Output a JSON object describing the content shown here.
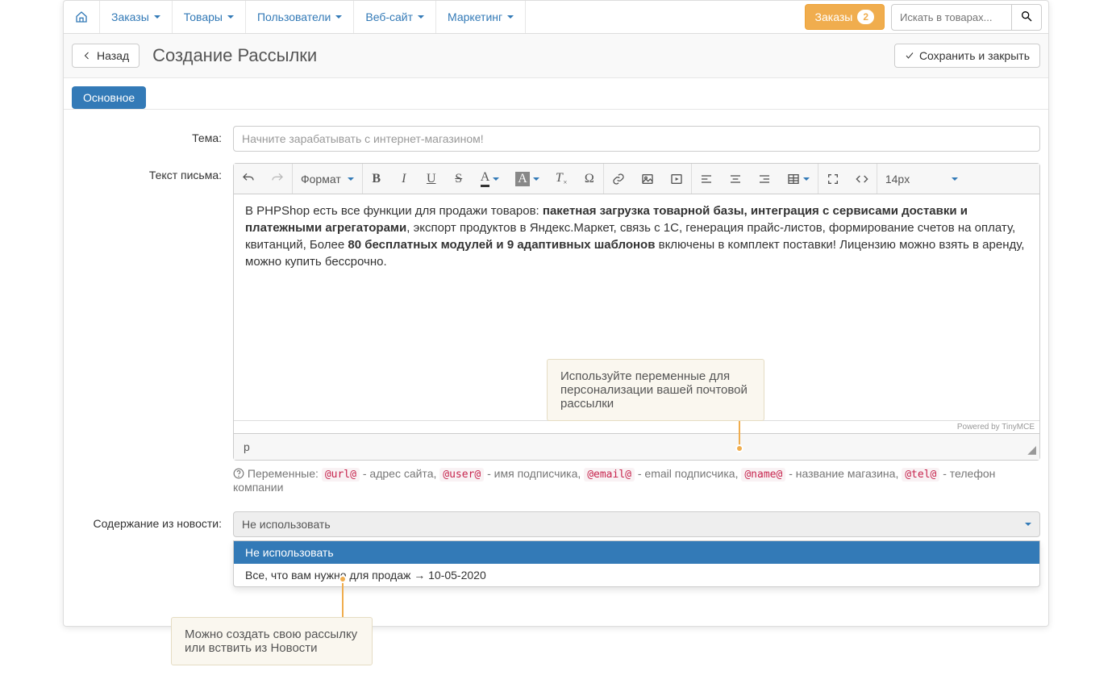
{
  "nav": {
    "items": [
      "Заказы",
      "Товары",
      "Пользователи",
      "Веб-сайт",
      "Маркетинг"
    ],
    "orders_button": "Заказы",
    "orders_badge": "2",
    "search_placeholder": "Искать в товарах..."
  },
  "header": {
    "back": "Назад",
    "title": "Создание Рассылки",
    "save": "Сохранить и закрыть"
  },
  "tabs": {
    "main": "Основное"
  },
  "form": {
    "subject_label": "Тема:",
    "subject_value": "Начните зарабатывать с интернет-магазином!",
    "body_label": "Текст письма:",
    "news_label": "Содержание из новости:"
  },
  "editor": {
    "format_label": "Формат",
    "fontsize_label": "14px",
    "powered": "Powered by TinyMCE",
    "path": "p",
    "content_pre": "В PHPShop есть все функции для продажи товаров: ",
    "content_bold1": "пакетная загрузка товарной базы, интеграция с сервисами доставки и платежными агрегаторами",
    "content_mid": ", экспорт продуктов в Яндекс.Маркет, связь с 1С, генерация прайс-листов, формирование счетов на оплату, квитанций, Более ",
    "content_bold2": "80 бесплатных модулей и 9 адаптивных шаблонов",
    "content_post": " включены в комплект поставки! Лицензию можно взять в аренду, можно купить бессрочно."
  },
  "variables": {
    "label": "Переменные: ",
    "url": "@url@",
    "url_desc": " - адрес сайта, ",
    "user": "@user@",
    "user_desc": " - имя подписчика, ",
    "email": "@email@",
    "email_desc": " - email подписчика, ",
    "name": "@name@",
    "name_desc": " - название магазина, ",
    "tel": "@tel@",
    "tel_desc": " - телефон компании"
  },
  "news_select": {
    "selected": "Не использовать",
    "options": [
      "Не использовать",
      "Все, что вам нужно для продаж → 10-05-2020"
    ]
  },
  "callouts": {
    "vars": "Используйте переменные для персонализации вашей почтовой рассылки",
    "news": "Можно создать свою рассылку или вствить из Новости"
  }
}
